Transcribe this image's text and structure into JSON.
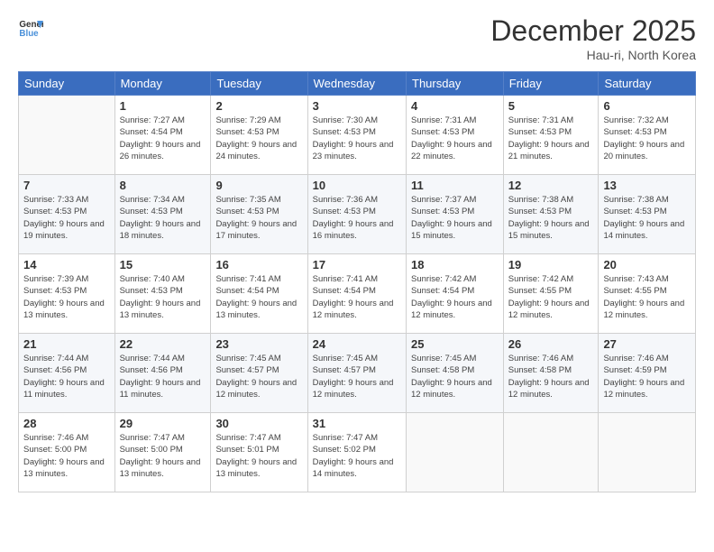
{
  "logo": {
    "line1": "General",
    "line2": "Blue"
  },
  "header": {
    "month": "December 2025",
    "location": "Hau-ri, North Korea"
  },
  "weekdays": [
    "Sunday",
    "Monday",
    "Tuesday",
    "Wednesday",
    "Thursday",
    "Friday",
    "Saturday"
  ],
  "weeks": [
    [
      {
        "day": "",
        "sunrise": "",
        "sunset": "",
        "daylight": ""
      },
      {
        "day": "1",
        "sunrise": "7:27 AM",
        "sunset": "4:54 PM",
        "daylight": "9 hours and 26 minutes."
      },
      {
        "day": "2",
        "sunrise": "7:29 AM",
        "sunset": "4:53 PM",
        "daylight": "9 hours and 24 minutes."
      },
      {
        "day": "3",
        "sunrise": "7:30 AM",
        "sunset": "4:53 PM",
        "daylight": "9 hours and 23 minutes."
      },
      {
        "day": "4",
        "sunrise": "7:31 AM",
        "sunset": "4:53 PM",
        "daylight": "9 hours and 22 minutes."
      },
      {
        "day": "5",
        "sunrise": "7:31 AM",
        "sunset": "4:53 PM",
        "daylight": "9 hours and 21 minutes."
      },
      {
        "day": "6",
        "sunrise": "7:32 AM",
        "sunset": "4:53 PM",
        "daylight": "9 hours and 20 minutes."
      }
    ],
    [
      {
        "day": "7",
        "sunrise": "7:33 AM",
        "sunset": "4:53 PM",
        "daylight": "9 hours and 19 minutes."
      },
      {
        "day": "8",
        "sunrise": "7:34 AM",
        "sunset": "4:53 PM",
        "daylight": "9 hours and 18 minutes."
      },
      {
        "day": "9",
        "sunrise": "7:35 AM",
        "sunset": "4:53 PM",
        "daylight": "9 hours and 17 minutes."
      },
      {
        "day": "10",
        "sunrise": "7:36 AM",
        "sunset": "4:53 PM",
        "daylight": "9 hours and 16 minutes."
      },
      {
        "day": "11",
        "sunrise": "7:37 AM",
        "sunset": "4:53 PM",
        "daylight": "9 hours and 15 minutes."
      },
      {
        "day": "12",
        "sunrise": "7:38 AM",
        "sunset": "4:53 PM",
        "daylight": "9 hours and 15 minutes."
      },
      {
        "day": "13",
        "sunrise": "7:38 AM",
        "sunset": "4:53 PM",
        "daylight": "9 hours and 14 minutes."
      }
    ],
    [
      {
        "day": "14",
        "sunrise": "7:39 AM",
        "sunset": "4:53 PM",
        "daylight": "9 hours and 13 minutes."
      },
      {
        "day": "15",
        "sunrise": "7:40 AM",
        "sunset": "4:53 PM",
        "daylight": "9 hours and 13 minutes."
      },
      {
        "day": "16",
        "sunrise": "7:41 AM",
        "sunset": "4:54 PM",
        "daylight": "9 hours and 13 minutes."
      },
      {
        "day": "17",
        "sunrise": "7:41 AM",
        "sunset": "4:54 PM",
        "daylight": "9 hours and 12 minutes."
      },
      {
        "day": "18",
        "sunrise": "7:42 AM",
        "sunset": "4:54 PM",
        "daylight": "9 hours and 12 minutes."
      },
      {
        "day": "19",
        "sunrise": "7:42 AM",
        "sunset": "4:55 PM",
        "daylight": "9 hours and 12 minutes."
      },
      {
        "day": "20",
        "sunrise": "7:43 AM",
        "sunset": "4:55 PM",
        "daylight": "9 hours and 12 minutes."
      }
    ],
    [
      {
        "day": "21",
        "sunrise": "7:44 AM",
        "sunset": "4:56 PM",
        "daylight": "9 hours and 11 minutes."
      },
      {
        "day": "22",
        "sunrise": "7:44 AM",
        "sunset": "4:56 PM",
        "daylight": "9 hours and 11 minutes."
      },
      {
        "day": "23",
        "sunrise": "7:45 AM",
        "sunset": "4:57 PM",
        "daylight": "9 hours and 12 minutes."
      },
      {
        "day": "24",
        "sunrise": "7:45 AM",
        "sunset": "4:57 PM",
        "daylight": "9 hours and 12 minutes."
      },
      {
        "day": "25",
        "sunrise": "7:45 AM",
        "sunset": "4:58 PM",
        "daylight": "9 hours and 12 minutes."
      },
      {
        "day": "26",
        "sunrise": "7:46 AM",
        "sunset": "4:58 PM",
        "daylight": "9 hours and 12 minutes."
      },
      {
        "day": "27",
        "sunrise": "7:46 AM",
        "sunset": "4:59 PM",
        "daylight": "9 hours and 12 minutes."
      }
    ],
    [
      {
        "day": "28",
        "sunrise": "7:46 AM",
        "sunset": "5:00 PM",
        "daylight": "9 hours and 13 minutes."
      },
      {
        "day": "29",
        "sunrise": "7:47 AM",
        "sunset": "5:00 PM",
        "daylight": "9 hours and 13 minutes."
      },
      {
        "day": "30",
        "sunrise": "7:47 AM",
        "sunset": "5:01 PM",
        "daylight": "9 hours and 13 minutes."
      },
      {
        "day": "31",
        "sunrise": "7:47 AM",
        "sunset": "5:02 PM",
        "daylight": "9 hours and 14 minutes."
      },
      {
        "day": "",
        "sunrise": "",
        "sunset": "",
        "daylight": ""
      },
      {
        "day": "",
        "sunrise": "",
        "sunset": "",
        "daylight": ""
      },
      {
        "day": "",
        "sunrise": "",
        "sunset": "",
        "daylight": ""
      }
    ]
  ]
}
